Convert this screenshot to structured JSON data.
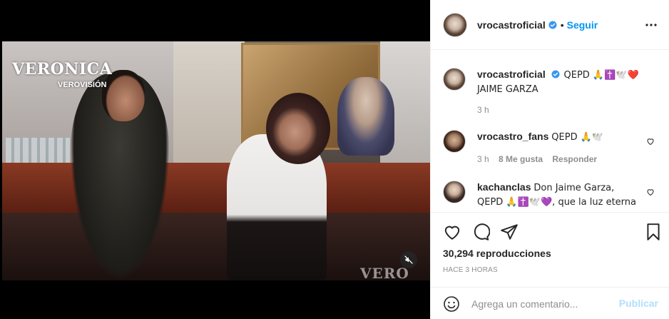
{
  "video": {
    "watermark_title": "VERONICA",
    "watermark_sub": "VEROVISIÓN",
    "watermark_corner": "VERO"
  },
  "header": {
    "username": "vrocastroficial",
    "separator": "•",
    "follow_label": "Seguir"
  },
  "caption": {
    "username": "vrocastroficial",
    "text": "QEPD 🙏✝️🕊️❤️ JAIME GARZA",
    "time": "3 h"
  },
  "comments": [
    {
      "username": "vrocastro_fans",
      "text": "QEPD 🙏🕊️",
      "time": "3 h",
      "likes": "8 Me gusta",
      "reply": "Responder"
    },
    {
      "username": "kachanclas",
      "text": "Don Jaime Garza, QEPD 🙏✝️🕊️💜, que la luz eterna brille para él 🕊️"
    }
  ],
  "stats": {
    "views": "30,294 reproducciones",
    "time_ago": "HACE 3 HORAS"
  },
  "composer": {
    "placeholder": "Agrega un comentario...",
    "publish_label": "Publicar"
  },
  "colors": {
    "link_blue": "#0095f6",
    "publish_disabled": "#b2dffc",
    "muted_text": "#8e8e8e"
  },
  "icons": [
    "verified-badge-icon",
    "more-options-icon",
    "heart-icon",
    "comment-icon",
    "share-icon",
    "bookmark-icon",
    "emoji-icon",
    "muted-audio-icon"
  ]
}
